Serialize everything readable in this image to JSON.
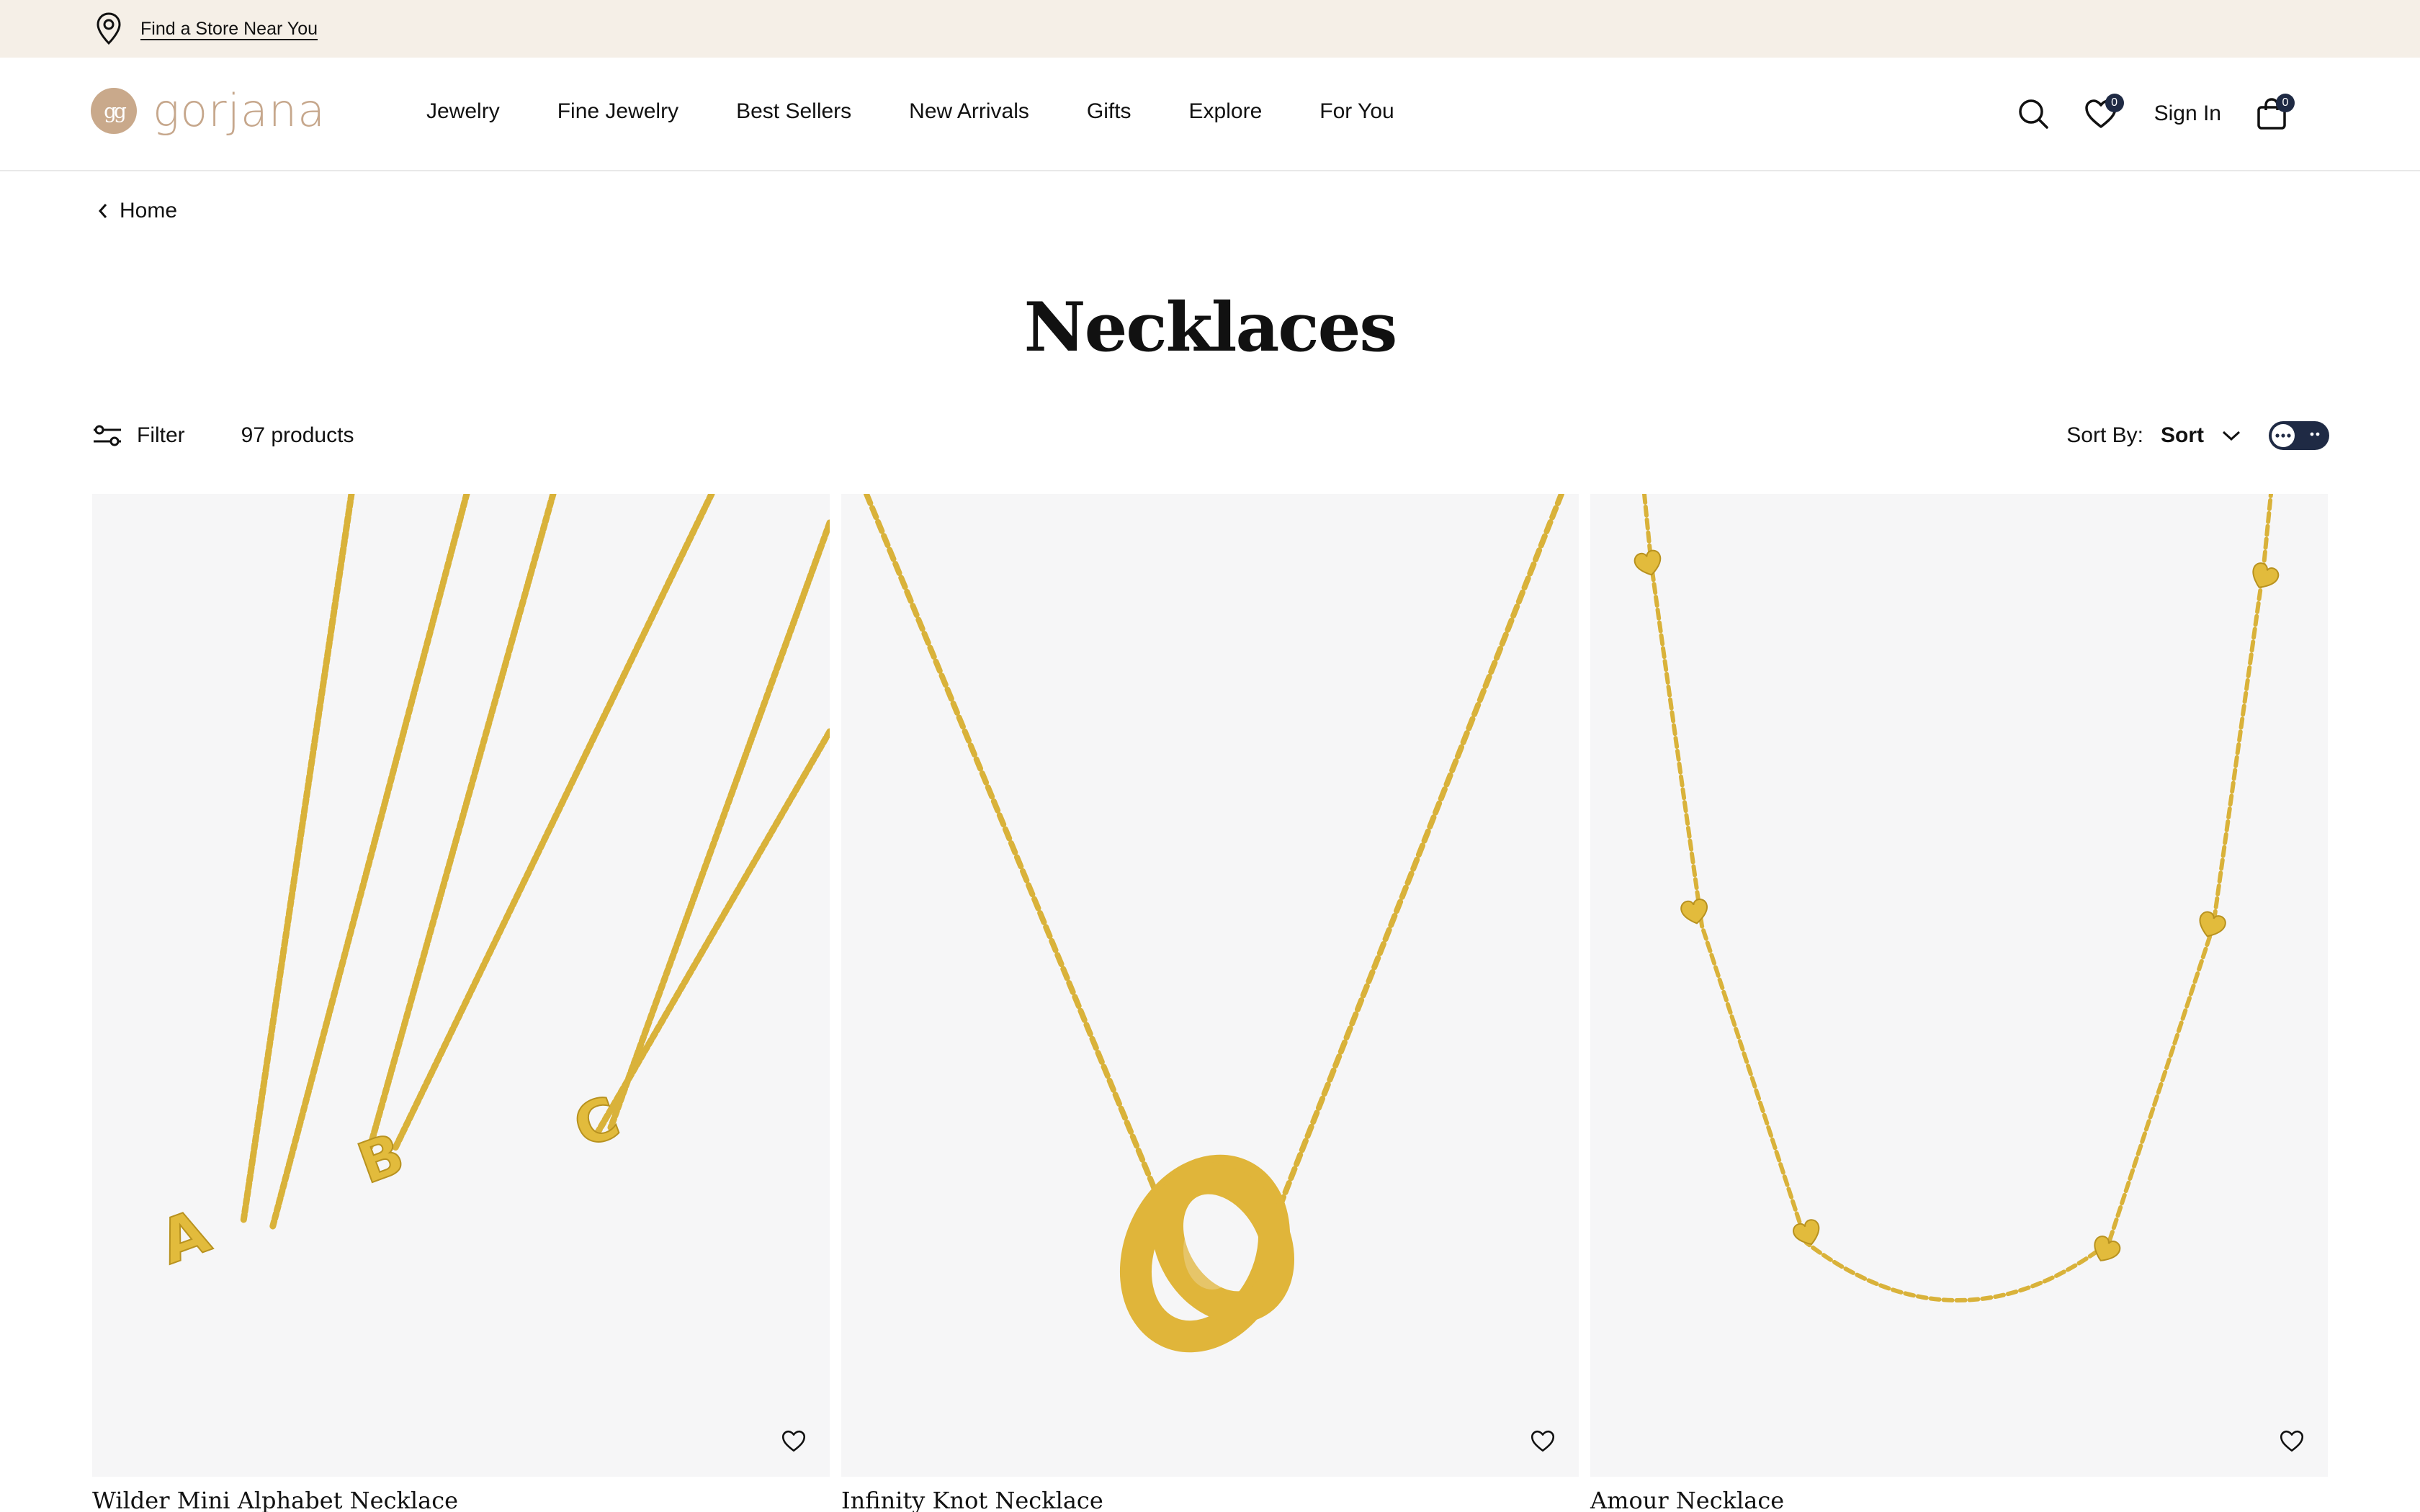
{
  "topbar": {
    "store_link": "Find a Store Near You"
  },
  "header": {
    "logo_text": "gorjana",
    "logo_mark": "gg",
    "nav": [
      "Jewelry",
      "Fine Jewelry",
      "Best Sellers",
      "New Arrivals",
      "Gifts",
      "Explore",
      "For You"
    ],
    "wishlist_count": "0",
    "sign_in": "Sign In",
    "cart_count": "0",
    "icons": [
      "search-icon",
      "heart-icon",
      "shopping-bag-icon"
    ]
  },
  "breadcrumb": {
    "label": "Home"
  },
  "page": {
    "title": "Necklaces"
  },
  "toolbar": {
    "filter_label": "Filter",
    "product_count": "97 products",
    "sort_by_label": "Sort By:",
    "sort_value": "Sort"
  },
  "products": [
    {
      "name": "Wilder Mini Alphabet Necklace"
    },
    {
      "name": "Infinity Knot Necklace"
    },
    {
      "name": "Amour Necklace"
    }
  ],
  "colors": {
    "topbar_bg": "#f5efe7",
    "brand": "#c6a78c",
    "badge": "#1f2a44",
    "image_bg": "#f6f6f7",
    "gold": "#e2bb3c"
  }
}
